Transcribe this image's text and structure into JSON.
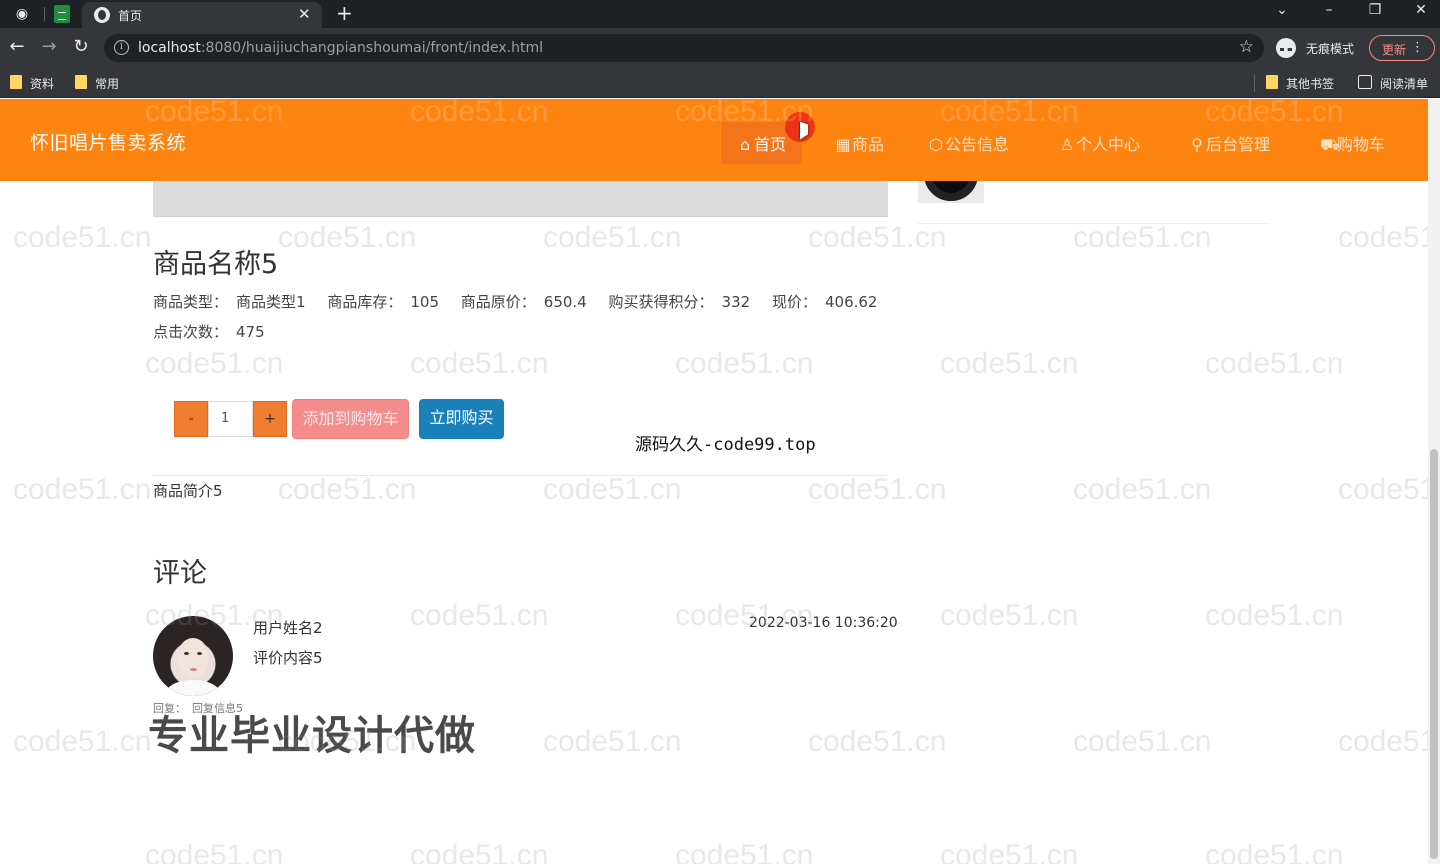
{
  "browser": {
    "tab_title": "首页",
    "url_host": "localhost",
    "url_rest": ":8080/huaijiuchangpianshoumai/front/index.html",
    "incognito_label": "无痕模式",
    "update_label": "更新",
    "bookmarks": [
      "资料",
      "常用"
    ],
    "other_bookmarks": "其他书签",
    "reading_list": "阅读清单"
  },
  "nav": {
    "brand": "怀旧唱片售卖系统",
    "items": [
      {
        "glyph": "⌂",
        "label": "首页"
      },
      {
        "glyph": "▦",
        "label": "商品"
      },
      {
        "glyph": "⬡",
        "label": "公告信息"
      },
      {
        "glyph": "♙",
        "label": "个人中心"
      },
      {
        "glyph": "⚲",
        "label": "后台管理"
      },
      {
        "glyph": "⛟",
        "label": "购物车"
      }
    ]
  },
  "product": {
    "name": "商品名称5",
    "type_label": "商品类型：",
    "type_value": "商品类型1",
    "stock_label": "商品库存：",
    "stock_value": "105",
    "orig_price_label": "商品原价：",
    "orig_price_value": "650.4",
    "points_label": "购买获得积分：",
    "points_value": "332",
    "price_label": "现价：",
    "price_value": "406.62",
    "clicks_label": "点击次数：",
    "clicks_value": "475",
    "description": "商品简介5"
  },
  "purchase": {
    "minus": "-",
    "quantity": "1",
    "plus": "+",
    "add_to_cart": "添加到购物车",
    "buy_now": "立即购买"
  },
  "comments": {
    "title": "评论",
    "items": [
      {
        "user": "用户姓名2",
        "content": "评价内容5",
        "time": "2022-03-16 10:36:20",
        "reply_label": "回复：",
        "reply_content": "回复信息5"
      }
    ]
  },
  "overlays": {
    "source_text": "源码久久-code99.top",
    "promo_text": "专业毕业设计代做",
    "watermark": "code51.cn"
  },
  "colors": {
    "nav_orange": "#fe8412",
    "cart_button": "#f48c8c",
    "buy_button": "#1980b9",
    "qty_button": "#f07c2f"
  }
}
